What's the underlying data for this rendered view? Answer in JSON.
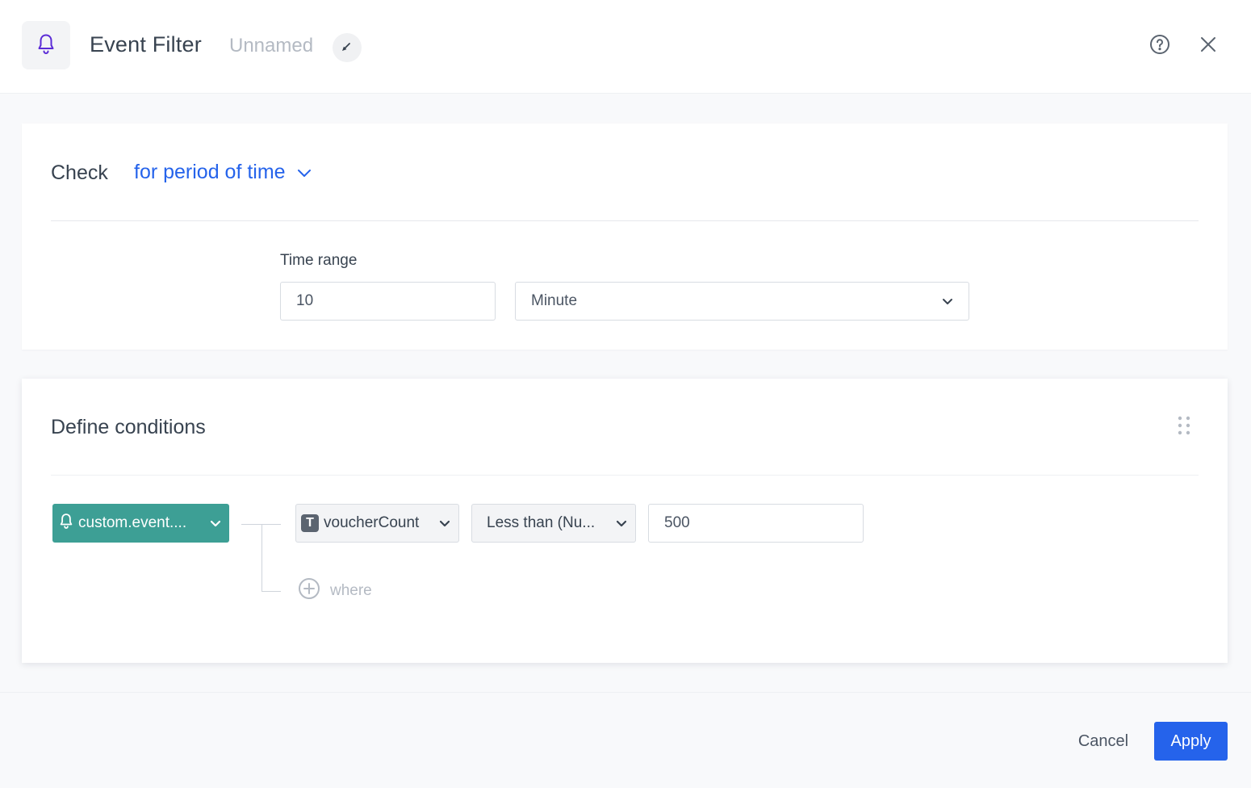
{
  "header": {
    "title": "Event Filter",
    "subtitle": "Unnamed",
    "icon": "bell-icon",
    "accent_color": "#5b2bd6"
  },
  "check_section": {
    "label": "Check",
    "mode": "for period of time",
    "mode_color": "#2563eb",
    "time_range": {
      "label": "Time range",
      "value": "10",
      "unit": "Minute"
    }
  },
  "conditions": {
    "title": "Define conditions",
    "event": {
      "label": "custom.event....",
      "color": "#3d9f95"
    },
    "parameter": {
      "type_badge": "T",
      "label": "voucherCount"
    },
    "operator": "Less than (Nu...",
    "value": "500",
    "add_where_label": "where"
  },
  "footer": {
    "cancel_label": "Cancel",
    "apply_label": "Apply",
    "apply_color": "#2563eb"
  }
}
